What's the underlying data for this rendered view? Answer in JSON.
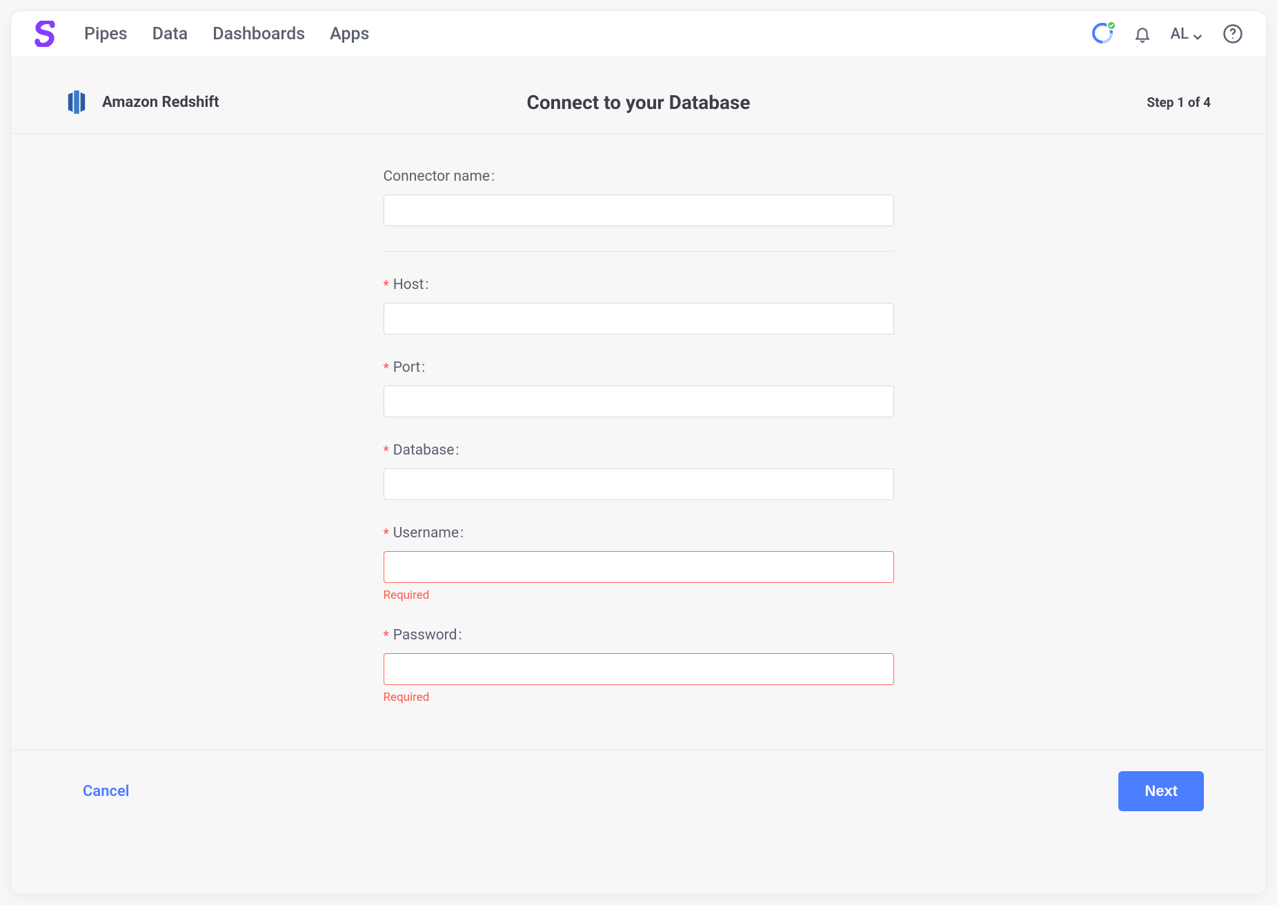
{
  "nav": {
    "items": [
      "Pipes",
      "Data",
      "Dashboards",
      "Apps"
    ]
  },
  "user": {
    "initials": "AL"
  },
  "page": {
    "source_name": "Amazon Redshift",
    "title": "Connect to your Database",
    "step_text": "Step 1 of 4"
  },
  "form": {
    "fields": {
      "connector_name": {
        "label": "Connector name",
        "required": false,
        "value": "",
        "error": ""
      },
      "host": {
        "label": "Host",
        "required": true,
        "value": "",
        "error": ""
      },
      "port": {
        "label": "Port",
        "required": true,
        "value": "",
        "error": ""
      },
      "database": {
        "label": "Database",
        "required": true,
        "value": "",
        "error": ""
      },
      "username": {
        "label": "Username",
        "required": true,
        "value": "",
        "error": "Required"
      },
      "password": {
        "label": "Password",
        "required": true,
        "value": "",
        "error": "Required"
      }
    }
  },
  "footer": {
    "cancel_label": "Cancel",
    "next_label": "Next"
  }
}
